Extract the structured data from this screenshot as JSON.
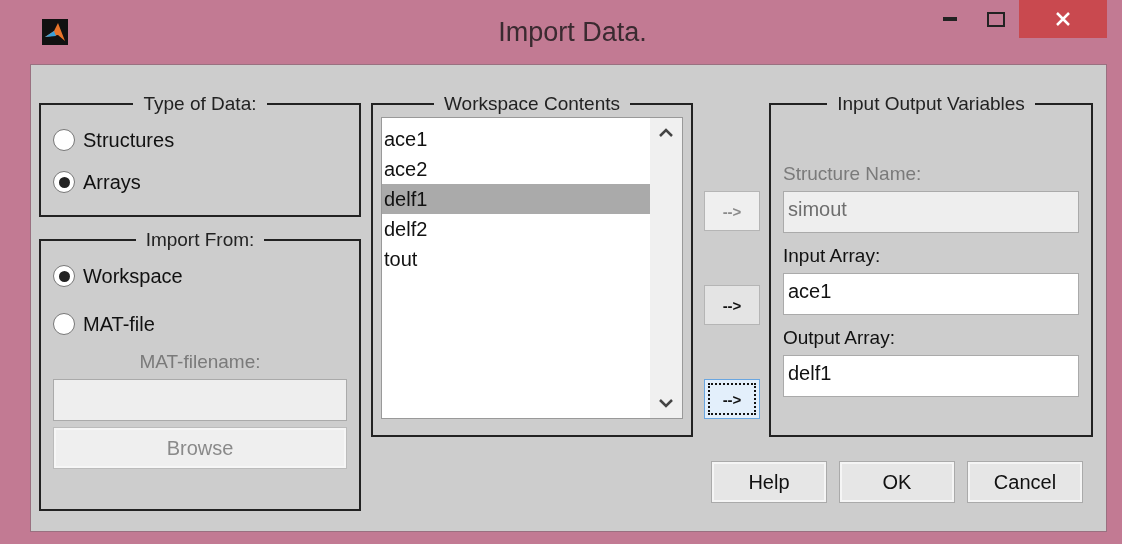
{
  "window": {
    "title": "Import Data."
  },
  "type_of_data": {
    "title": "Type of Data:",
    "options": [
      {
        "label": "Structures",
        "selected": false
      },
      {
        "label": "Arrays",
        "selected": true
      }
    ]
  },
  "import_from": {
    "title": "Import From:",
    "options": [
      {
        "label": "Workspace",
        "selected": true
      },
      {
        "label": "MAT-file",
        "selected": false
      }
    ],
    "filename_label": "MAT-filename:",
    "filename_disabled": true,
    "browse": {
      "label": "Browse",
      "disabled": true
    }
  },
  "workspace_contents": {
    "title": "Workspace Contents",
    "items": [
      {
        "label": "ace1",
        "selected": false
      },
      {
        "label": "ace2",
        "selected": false
      },
      {
        "label": "delf1",
        "selected": true
      },
      {
        "label": "delf2",
        "selected": false
      },
      {
        "label": "tout",
        "selected": false
      }
    ]
  },
  "arrow_buttons": [
    {
      "label": "-->",
      "disabled": true,
      "focused": false
    },
    {
      "label": "-->",
      "disabled": false,
      "focused": false
    },
    {
      "label": "-->",
      "disabled": false,
      "focused": true
    }
  ],
  "input_output_variables": {
    "title": "Input Output Variables",
    "fields": [
      {
        "label": "Structure Name:",
        "value": "simout",
        "disabled": true
      },
      {
        "label": "Input Array:",
        "value": "ace1",
        "disabled": false
      },
      {
        "label": "Output Array:",
        "value": "delf1",
        "disabled": false
      }
    ]
  },
  "buttons": [
    "Help",
    "OK",
    "Cancel"
  ]
}
